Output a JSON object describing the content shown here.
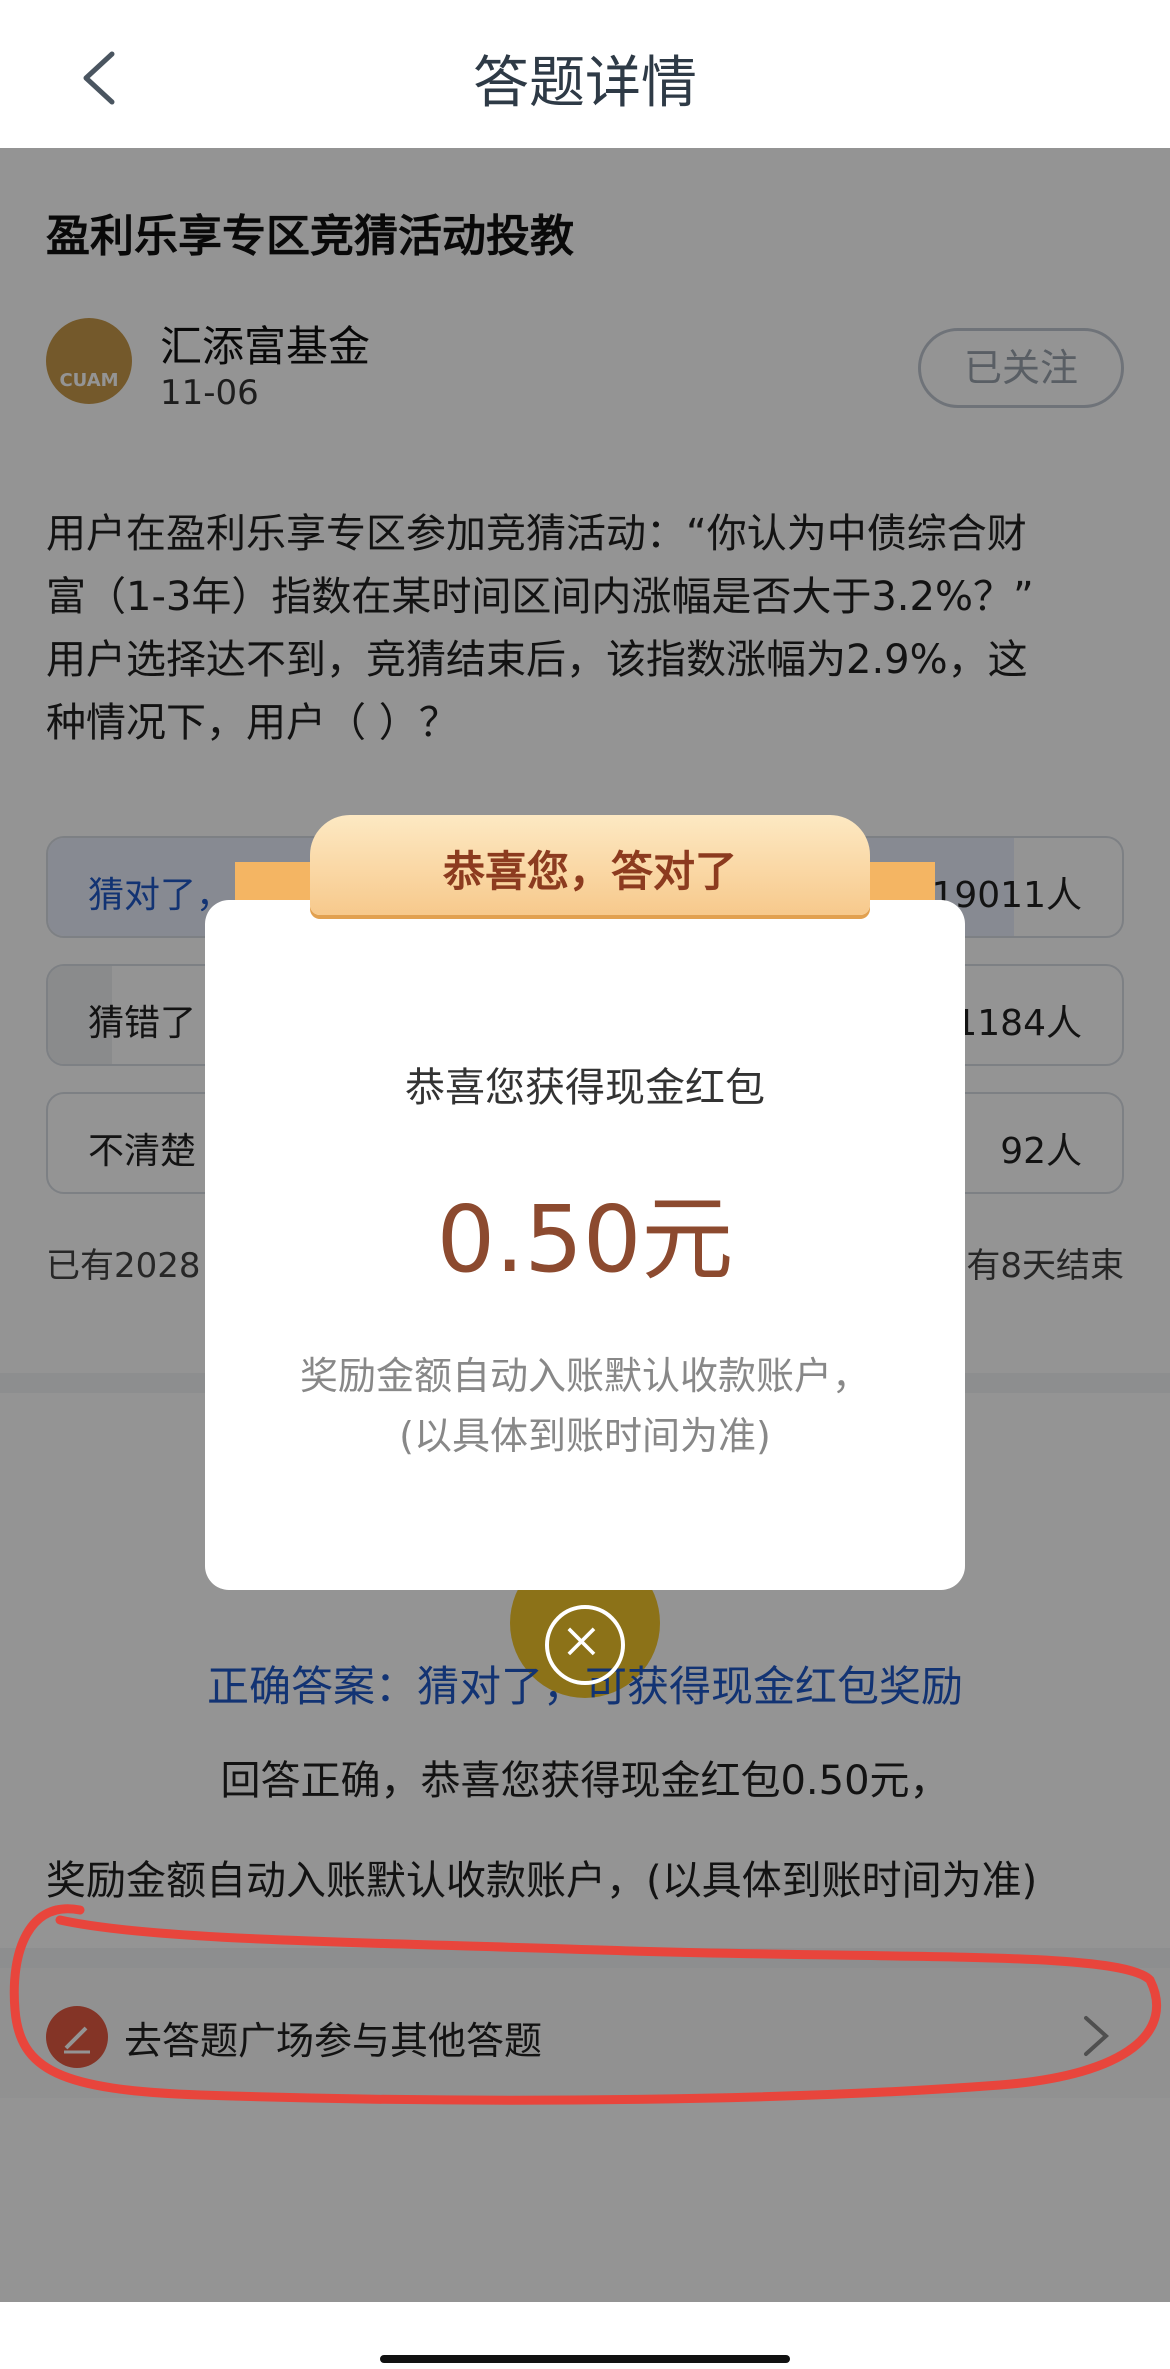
{
  "header": {
    "title": "答题详情",
    "back_icon": "chevron-left-icon"
  },
  "article": {
    "title": "盈利乐享专区竞猜活动投教",
    "author": "汇添富基金",
    "date": "11-06",
    "logo_text": "CUAM",
    "follow_label": "已关注",
    "question_lines": [
      "用户在盈利乐享专区参加竞猜活动：“你认为中债综合财",
      "富（1-3年）指数在某时间区间内涨幅是否大于3.2%？”",
      "用户选择达不到，竞猜结束后，该指数涨幅为2.9%，这",
      "种情况下，用户（  ）？"
    ]
  },
  "options": [
    {
      "label": "猜对了，",
      "count": "19011人",
      "share": 0.9
    },
    {
      "label": "猜错了",
      "count": "1184人",
      "share": 0.06
    },
    {
      "label": "不清楚",
      "count": "92人",
      "share": 0.005
    }
  ],
  "stats": {
    "left": "已有2028",
    "right": "有8天结束"
  },
  "result": {
    "answer": "正确答案：猜对了，可获得现金红包奖励",
    "line1": "回答正确，恭喜您获得现金红包0.50元，",
    "line2": "奖励金额自动入账默认收款账户，(以具体到账时间为准)"
  },
  "link": {
    "label": "去答题广场参与其他答题",
    "icon": "pencil-icon",
    "arrow": "chevron-right-icon"
  },
  "modal": {
    "ribbon": "恭喜您，答对了",
    "subtitle": "恭喜您获得现金红包",
    "amount": "0.50元",
    "note1": "奖励金额自动入账默认收款账户，",
    "note2": "(以具体到账时间为准)",
    "close_icon": "close-icon"
  },
  "colors": {
    "accent_blue": "#1f58c7",
    "amount_brown": "#8c4a2f",
    "annotation_red": "#e8453c"
  }
}
